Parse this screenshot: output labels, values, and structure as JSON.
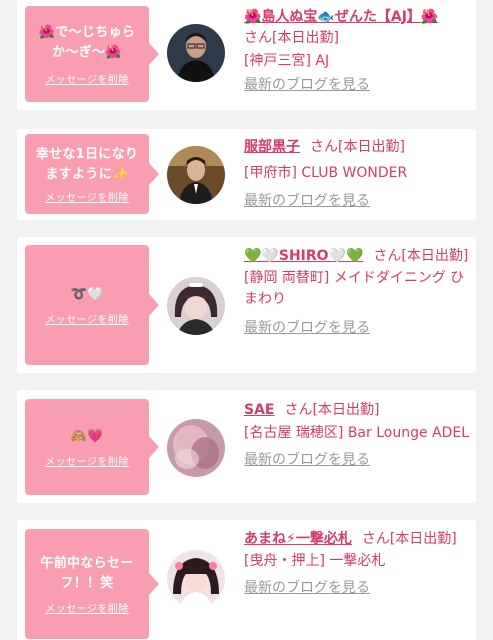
{
  "colors": {
    "accent": "#d63c6a",
    "bubble": "#f99eb0",
    "muted": "#999999"
  },
  "cards": [
    {
      "message": "🌺で〜じちゅらか〜ぎ〜🌺",
      "delete_label": "メッセージを削除",
      "avatar_icon": "person-avatar",
      "name": "🌺島人ぬ宝🐟ぜんた【AJ】🌺",
      "suffix": "さん[本日出勤]",
      "shop": "[神戸三宮] AJ",
      "blog_label": "最新のブログを見る"
    },
    {
      "message": "幸せな1日になりますように✨",
      "delete_label": "メッセージを削除",
      "avatar_icon": "person-avatar",
      "name": "服部黒子",
      "suffix": "さん[本日出勤]",
      "shop": "[甲府市] CLUB WONDER",
      "blog_label": "最新のブログを見る"
    },
    {
      "message": "➰🤍",
      "delete_label": "メッセージを削除",
      "avatar_icon": "person-avatar",
      "name": "💚🤍SHIRO🤍💚",
      "suffix": "さん[本日出勤]",
      "shop": "[静岡 両替町] メイドダイニング ひまわり",
      "blog_label": "最新のブログを見る"
    },
    {
      "message": "🙈💗",
      "delete_label": "メッセージを削除",
      "avatar_icon": "person-avatar",
      "name": "SAE",
      "suffix": "さん[本日出勤]",
      "shop": "[名古屋 瑞穂区] Bar Lounge ADEL",
      "blog_label": "最新のブログを見る"
    },
    {
      "message": "午前中ならセーフ！！笑",
      "delete_label": "メッセージを削除",
      "avatar_icon": "person-avatar",
      "name": "あまね⚡一撃必札",
      "suffix": "さん[本日出勤]",
      "shop": "[曳舟・押上] 一撃必札",
      "blog_label": "最新のブログを見る"
    }
  ]
}
